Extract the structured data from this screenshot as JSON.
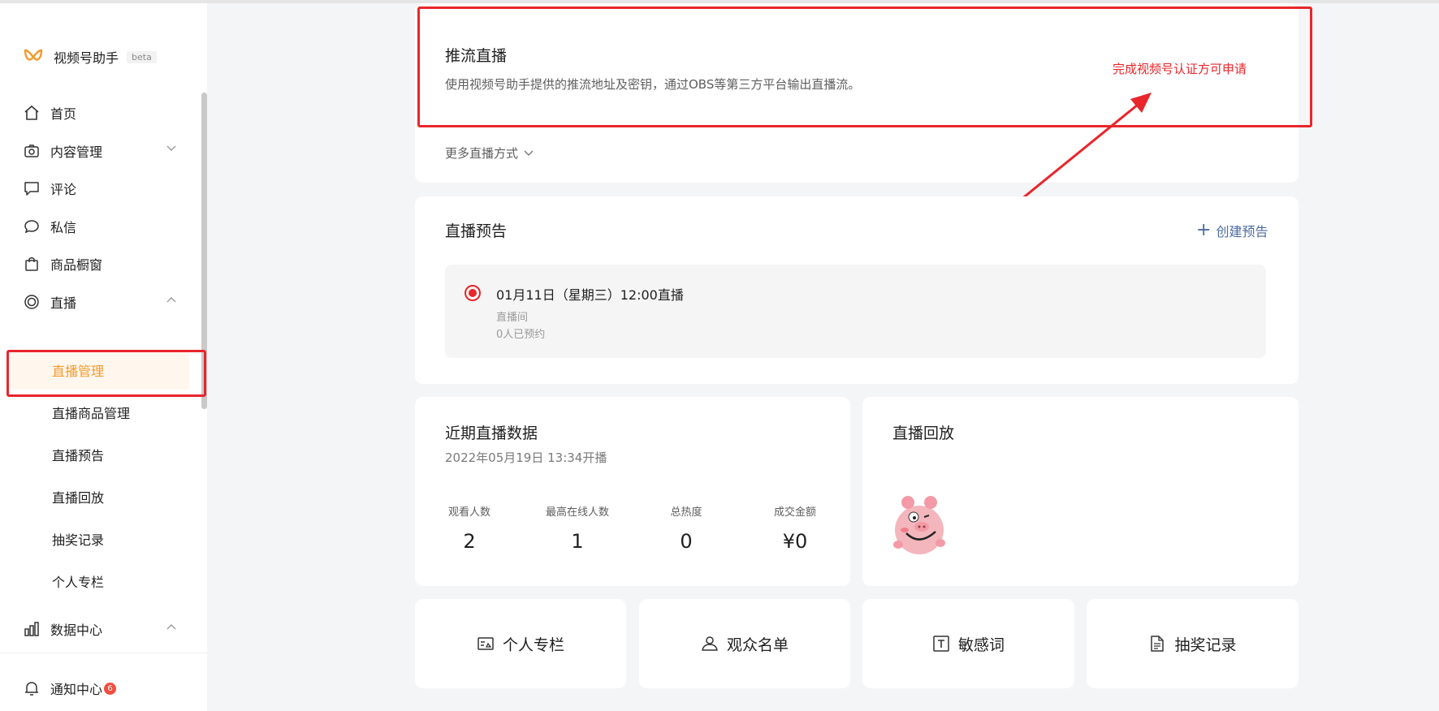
{
  "app": {
    "name": "视频号助手",
    "beta": "beta"
  },
  "sidebar": {
    "items": [
      {
        "label": "首页"
      },
      {
        "label": "内容管理"
      },
      {
        "label": "评论"
      },
      {
        "label": "私信"
      },
      {
        "label": "商品橱窗"
      },
      {
        "label": "直播"
      },
      {
        "label": "数据中心"
      }
    ],
    "live_sub": [
      {
        "label": "直播管理"
      },
      {
        "label": "直播商品管理"
      },
      {
        "label": "直播预告"
      },
      {
        "label": "直播回放"
      },
      {
        "label": "抽奖记录"
      },
      {
        "label": "个人专栏"
      }
    ],
    "notification": {
      "label": "通知中心",
      "count": "6"
    }
  },
  "push_stream": {
    "title": "推流直播",
    "desc": "使用视频号助手提供的推流地址及密钥，通过OBS等第三方平台输出直播流。",
    "note": "完成视频号认证方可申请",
    "more": "更多直播方式"
  },
  "preview": {
    "title": "直播预告",
    "create": "创建预告",
    "item": {
      "time": "01月11日（星期三）12:00直播",
      "room": "直播间",
      "reserved": "0人已预约"
    }
  },
  "recent": {
    "title": "近期直播数据",
    "time": "2022年05月19日 13:34开播",
    "stats": [
      {
        "label": "观看人数",
        "value": "2"
      },
      {
        "label": "最高在线人数",
        "value": "1"
      },
      {
        "label": "总热度",
        "value": "0"
      },
      {
        "label": "成交金额",
        "value": "¥0"
      }
    ]
  },
  "replay": {
    "title": "直播回放"
  },
  "tiles": [
    {
      "label": "个人专栏",
      "icon": "column-icon"
    },
    {
      "label": "观众名单",
      "icon": "audience-icon"
    },
    {
      "label": "敏感词",
      "icon": "text-icon"
    },
    {
      "label": "抽奖记录",
      "icon": "document-icon"
    }
  ],
  "colors": {
    "accent": "#f29a2e",
    "annotation": "#e8262b",
    "link": "#4c6b9d"
  }
}
